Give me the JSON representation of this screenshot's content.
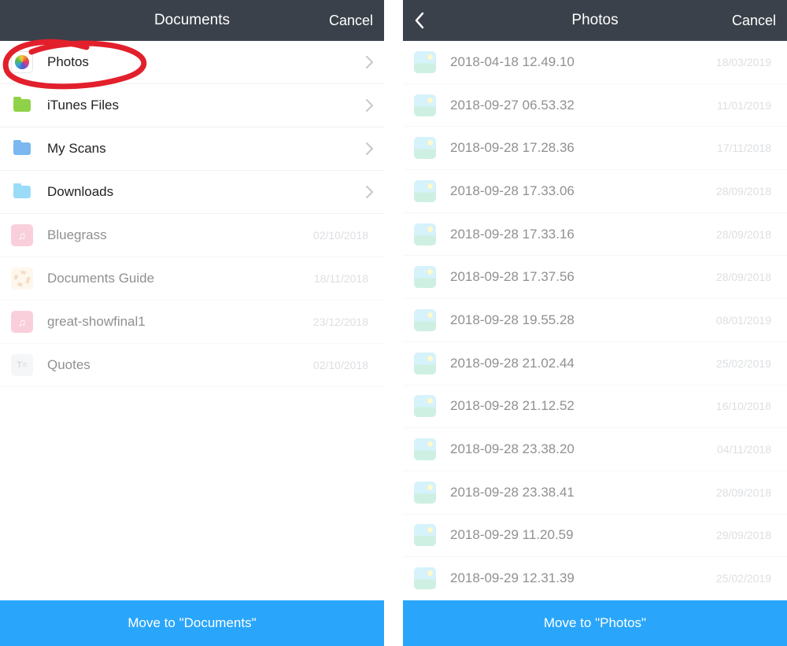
{
  "left": {
    "title": "Documents",
    "cancel": "Cancel",
    "footer": "Move to \"Documents\"",
    "items": [
      {
        "name": "Photos",
        "icon": "photos",
        "hasChevron": true,
        "date": ""
      },
      {
        "name": "iTunes Files",
        "icon": "folder-green",
        "hasChevron": true,
        "date": ""
      },
      {
        "name": "My Scans",
        "icon": "folder-blue",
        "hasChevron": true,
        "date": ""
      },
      {
        "name": "Downloads",
        "icon": "folder-cyan",
        "hasChevron": true,
        "date": ""
      },
      {
        "name": "Bluegrass",
        "icon": "music",
        "hasChevron": false,
        "date": "02/10/2018",
        "faded": true
      },
      {
        "name": "Documents Guide",
        "icon": "life",
        "hasChevron": false,
        "date": "18/11/2018",
        "faded": true
      },
      {
        "name": "great-showfinal1",
        "icon": "music",
        "hasChevron": false,
        "date": "23/12/2018",
        "faded": true
      },
      {
        "name": "Quotes",
        "icon": "text",
        "hasChevron": false,
        "date": "02/10/2018",
        "faded": true
      }
    ]
  },
  "right": {
    "title": "Photos",
    "cancel": "Cancel",
    "footer": "Move to \"Photos\"",
    "faded": true,
    "items": [
      {
        "name": "2018-04-18 12.49.10",
        "date": "18/03/2019"
      },
      {
        "name": "2018-09-27 06.53.32",
        "date": "11/01/2019"
      },
      {
        "name": "2018-09-28 17.28.36",
        "date": "17/11/2018"
      },
      {
        "name": "2018-09-28 17.33.06",
        "date": "28/09/2018"
      },
      {
        "name": "2018-09-28 17.33.16",
        "date": "28/09/2018"
      },
      {
        "name": "2018-09-28 17.37.56",
        "date": "28/09/2018"
      },
      {
        "name": "2018-09-28 19.55.28",
        "date": "08/01/2019"
      },
      {
        "name": "2018-09-28 21.02.44",
        "date": "25/02/2019"
      },
      {
        "name": "2018-09-28 21.12.52",
        "date": "16/10/2018"
      },
      {
        "name": "2018-09-28 23.38.20",
        "date": "04/11/2018"
      },
      {
        "name": "2018-09-28 23.38.41",
        "date": "28/09/2018"
      },
      {
        "name": "2018-09-29 11.20.59",
        "date": "29/09/2018"
      },
      {
        "name": "2018-09-29 12.31.39",
        "date": "25/02/2019"
      }
    ]
  }
}
